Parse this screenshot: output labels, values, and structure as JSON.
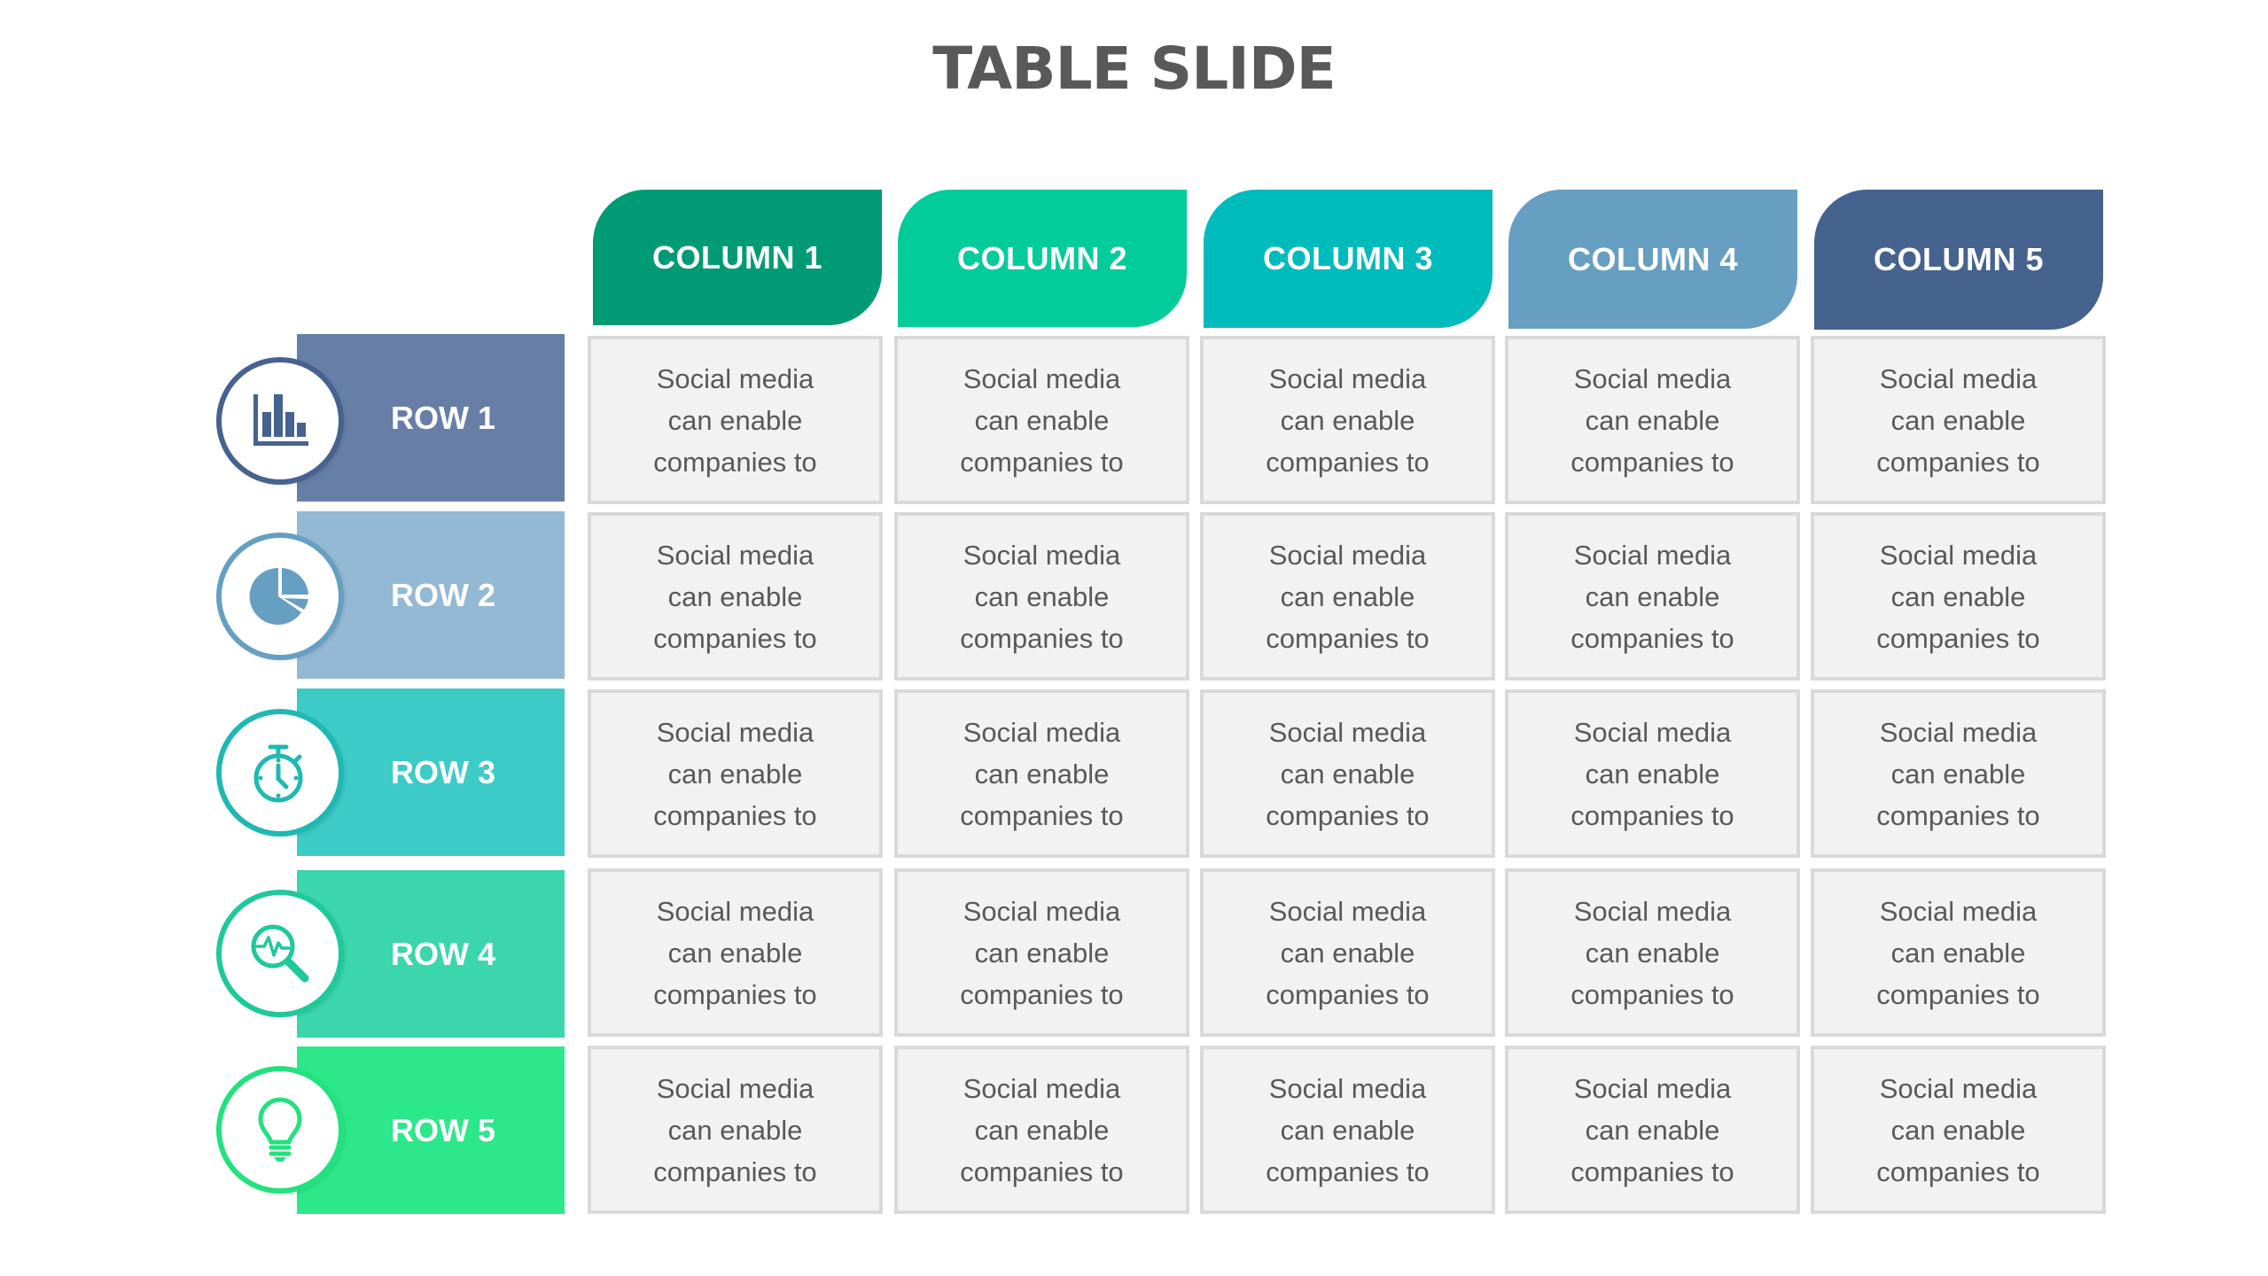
{
  "title": "TABLE SLIDE",
  "columns": [
    {
      "label": "COLUMN 1",
      "color": "#009b74"
    },
    {
      "label": "COLUMN 2",
      "color": "#02cc9a"
    },
    {
      "label": "COLUMN 3",
      "color": "#00bbbb"
    },
    {
      "label": "COLUMN 4",
      "color": "#679fc2"
    },
    {
      "label": "COLUMN 5",
      "color": "#46628f"
    }
  ],
  "rows": [
    {
      "label": "ROW 1",
      "icon": "bar-chart-icon",
      "band_color": "#677fa6",
      "icon_color": "#46628f"
    },
    {
      "label": "ROW 2",
      "icon": "pie-chart-icon",
      "band_color": "#93b9d4",
      "icon_color": "#679fc2"
    },
    {
      "label": "ROW 3",
      "icon": "stopwatch-icon",
      "band_color": "#3ccbc6",
      "icon_color": "#1fb8b2"
    },
    {
      "label": "ROW 4",
      "icon": "magnifier-pulse-icon",
      "band_color": "#3bd6ab",
      "icon_color": "#1ec99a"
    },
    {
      "label": "ROW 5",
      "icon": "lightbulb-icon",
      "band_color": "#2ce88a",
      "icon_color": "#22e27e"
    }
  ],
  "cells": [
    [
      "Social media can enable companies to",
      "Social media can enable companies to",
      "Social media can enable companies to",
      "Social media can enable companies to",
      "Social media can enable companies to"
    ],
    [
      "Social media can enable companies to",
      "Social media can enable companies to",
      "Social media can enable companies to",
      "Social media can enable companies to",
      "Social media can enable companies to"
    ],
    [
      "Social media can enable companies to",
      "Social media can enable companies to",
      "Social media can enable companies to",
      "Social media can enable companies to",
      "Social media can enable companies to"
    ],
    [
      "Social media can enable companies to",
      "Social media can enable companies to",
      "Social media can enable companies to",
      "Social media can enable companies to",
      "Social media can enable companies to"
    ],
    [
      "Social media can enable companies to",
      "Social media can enable companies to",
      "Social media can enable companies to",
      "Social media can enable companies to",
      "Social media can enable companies to"
    ]
  ]
}
